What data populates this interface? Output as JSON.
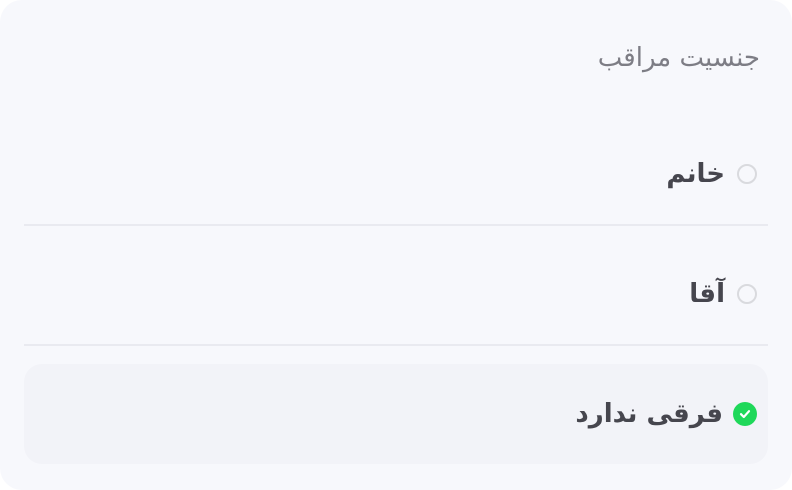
{
  "title": "جنسیت مراقب",
  "options": [
    {
      "label": "خانم",
      "selected": false
    },
    {
      "label": "آقا",
      "selected": false
    },
    {
      "label": "فرقی ندارد",
      "selected": true
    }
  ],
  "colors": {
    "background": "#f7f8fc",
    "selected_row": "#f2f3f8",
    "check_green": "#1fd85a",
    "radio_border": "#d9dade",
    "title_text": "#7d7d85",
    "label_text": "#46464e"
  },
  "icons": {
    "checked": "check-circle-icon",
    "unchecked": "radio-empty-icon"
  }
}
